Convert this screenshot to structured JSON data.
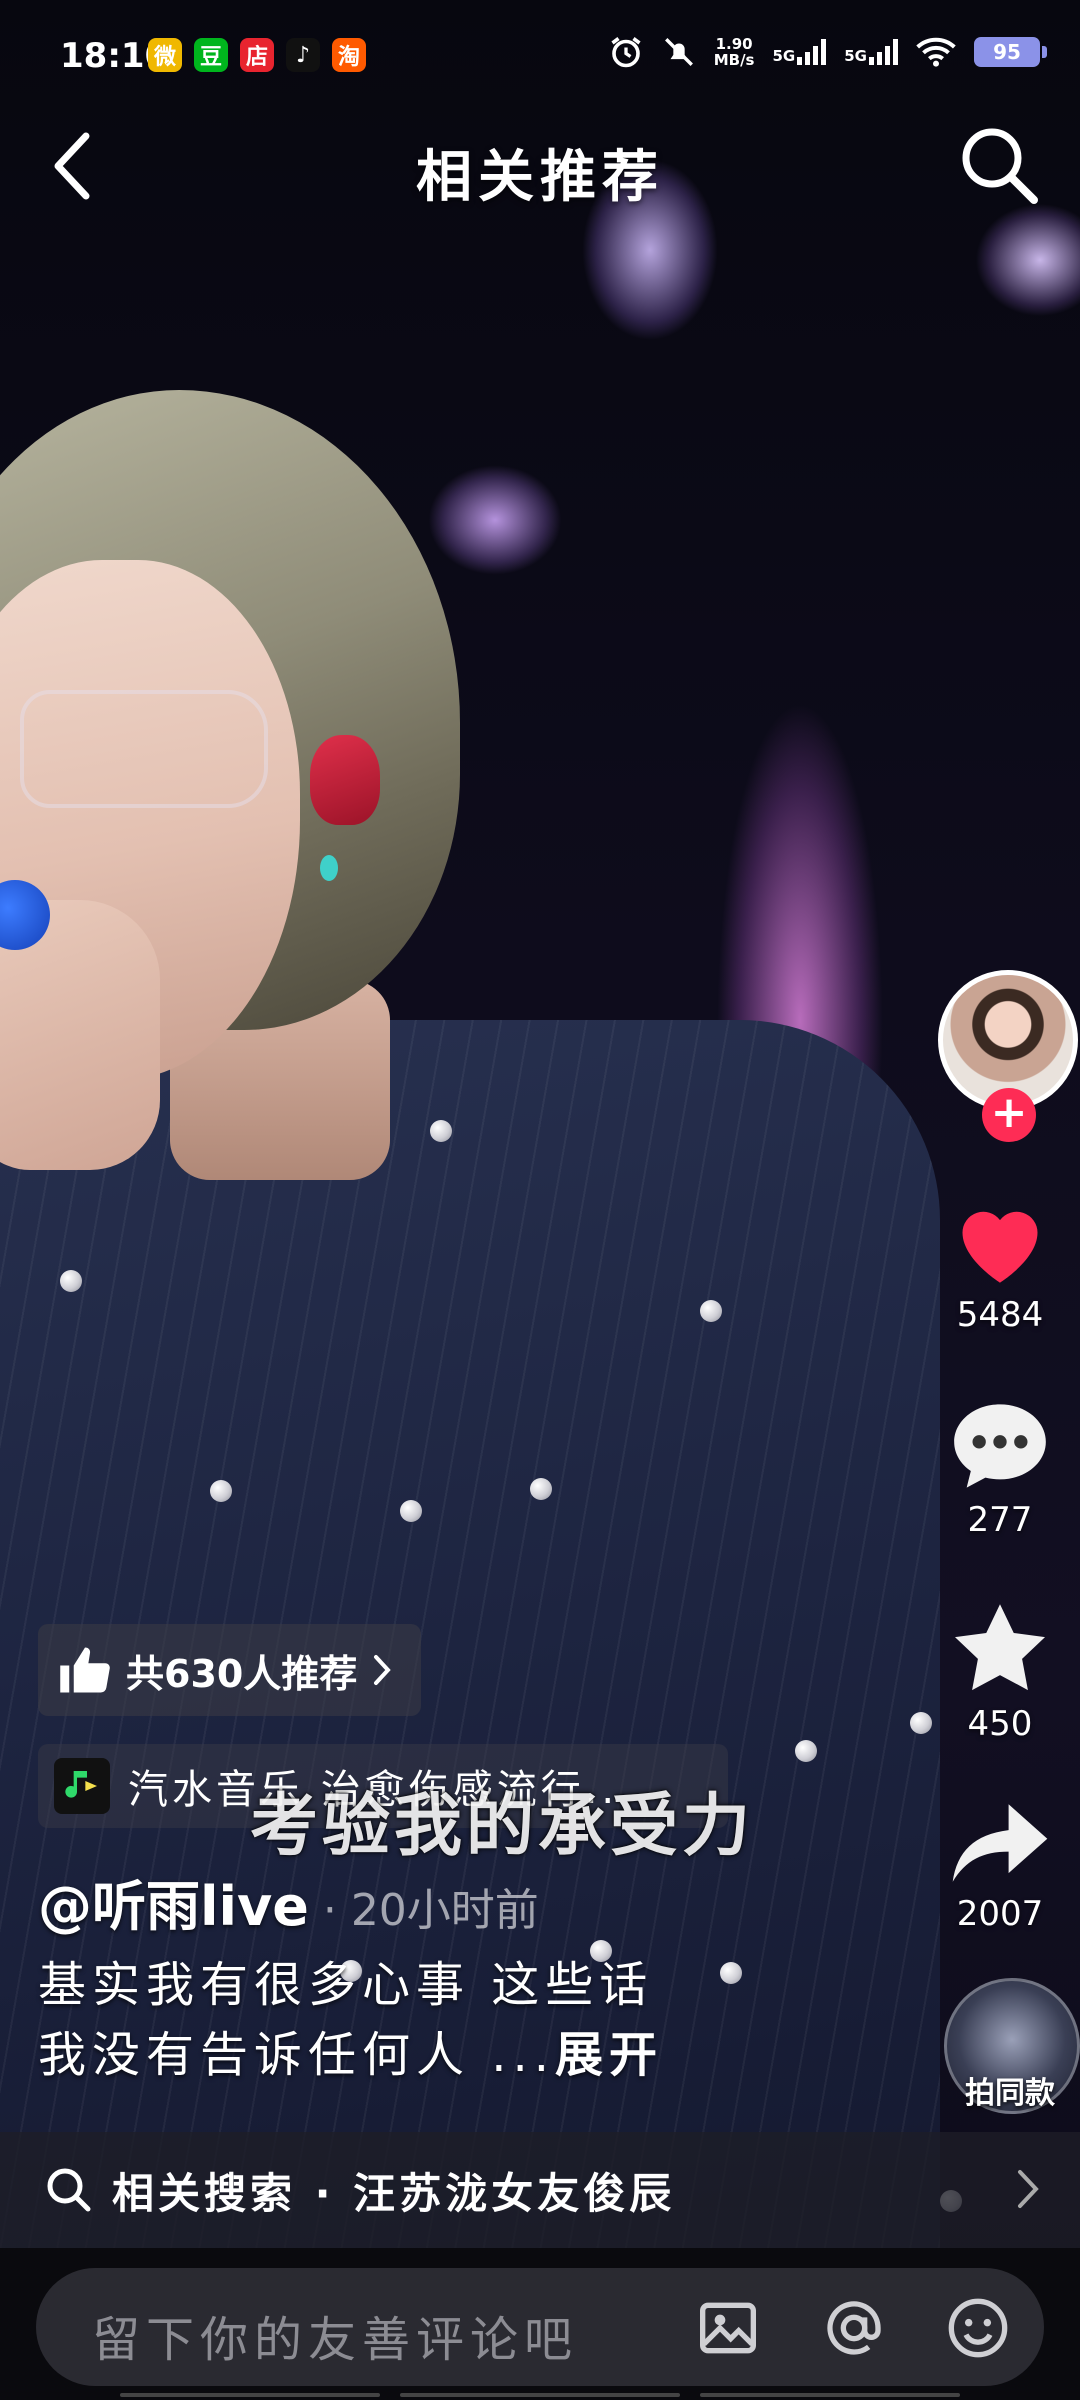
{
  "status_bar": {
    "time": "18:10",
    "app_badges": [
      {
        "icon": "weibo-icon",
        "glyph": "微",
        "color": "#f0b800"
      },
      {
        "icon": "douban-icon",
        "glyph": "豆",
        "color": "#00b51d"
      },
      {
        "icon": "store-icon",
        "glyph": "店",
        "color": "#e8242f"
      },
      {
        "icon": "tiktok-icon",
        "glyph": "♪",
        "color": "#111111"
      },
      {
        "icon": "taobao-icon",
        "glyph": "淘",
        "color": "#ff5a00"
      }
    ],
    "net_speed_value": "1.90",
    "net_speed_unit": "MB/s",
    "sim1": "5G",
    "sim2": "5G",
    "battery": "95"
  },
  "nav": {
    "title": "相关推荐"
  },
  "right_rail": {
    "likes": "5484",
    "comments": "277",
    "favorites": "450",
    "shares": "2007",
    "same_style": "拍同款",
    "accent": "#fe2c55"
  },
  "video": {
    "recommend_text": "共630人推荐",
    "music": "汽水音乐  治愈伤感流行..",
    "lyric": "考验我的承受力",
    "author": "@听雨live",
    "post_time": "· 20小时前",
    "caption_line1": "基实我有很多心事 这些话",
    "caption_line2": "我没有告诉任何人 ...",
    "expand": "展开"
  },
  "related_search": {
    "text": "相关搜索 · 汪苏泷女友俊辰"
  },
  "comment": {
    "placeholder": "留下你的友善评论吧"
  }
}
